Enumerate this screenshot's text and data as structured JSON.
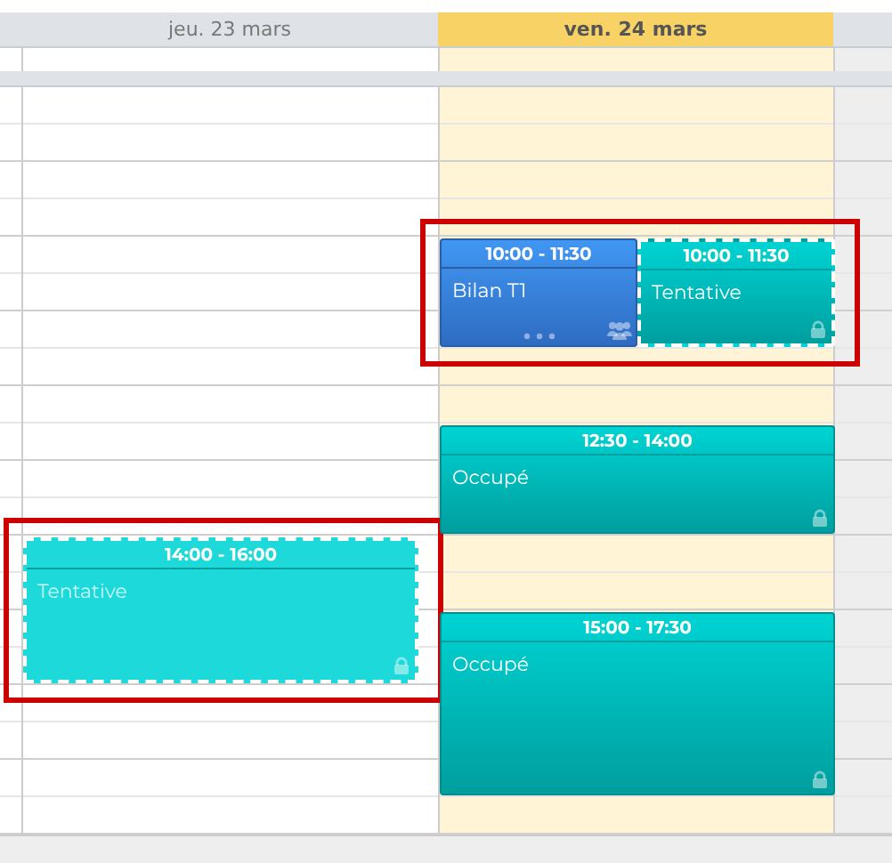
{
  "days": [
    {
      "label": "jeu. 23 mars",
      "today": false,
      "events": [
        {
          "kind": "tentative",
          "time": "14:00 - 16:00",
          "title": "Tentative",
          "selected": true,
          "highlighted": true
        }
      ]
    },
    {
      "label": "ven. 24 mars",
      "today": true,
      "events": [
        {
          "kind": "meeting",
          "time": "10:00 - 11:30",
          "title": "Bilan T1",
          "selected": false,
          "highlighted": true
        },
        {
          "kind": "tentative",
          "time": "10:00 - 11:30",
          "title": "Tentative",
          "selected": false,
          "highlighted": true
        },
        {
          "kind": "busy",
          "time": "12:30 - 14:00",
          "title": "Occupé",
          "selected": false,
          "highlighted": false
        },
        {
          "kind": "busy",
          "time": "15:00 - 17:30",
          "title": "Occupé",
          "selected": false,
          "highlighted": false
        }
      ]
    }
  ]
}
